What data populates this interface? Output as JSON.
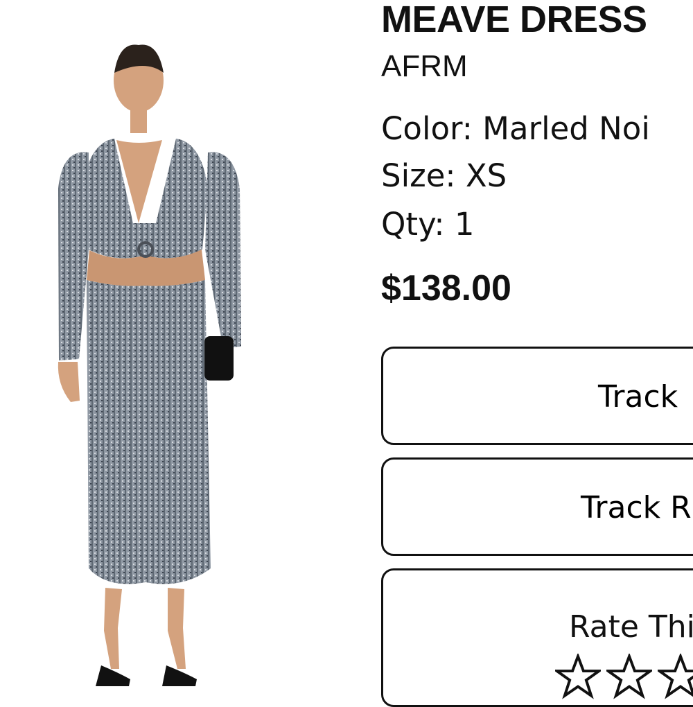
{
  "product": {
    "title": "MEAVE DRESS",
    "brand": "AFRM",
    "color_label": "Color: Marled Noi",
    "size_label": "Size: XS",
    "qty_label": "Qty: 1",
    "price": "$138.00",
    "image_icon": "product-photo-dress"
  },
  "actions": {
    "track_order": "Track",
    "track_return": "Track R",
    "rate_label": "Rate Thi"
  },
  "rating": {
    "max_visible": 3,
    "selected": 0
  },
  "colors": {
    "text": "#111111",
    "border": "#111111",
    "background": "#ffffff"
  }
}
